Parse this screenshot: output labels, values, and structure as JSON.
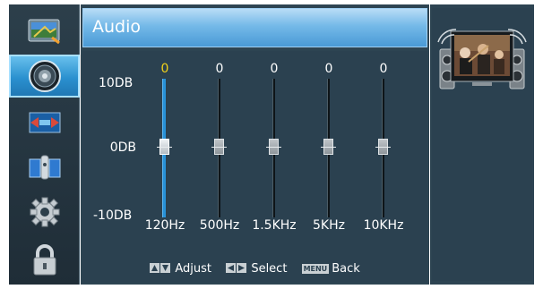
{
  "menu": {
    "title": "Audio",
    "sidebar": [
      {
        "icon": "picture-icon",
        "selected": false
      },
      {
        "icon": "speaker-icon",
        "selected": true
      },
      {
        "icon": "screen-icon",
        "selected": false
      },
      {
        "icon": "satellite-icon",
        "selected": false
      },
      {
        "icon": "gear-icon",
        "selected": false
      },
      {
        "icon": "lock-icon",
        "selected": false
      }
    ]
  },
  "equalizer": {
    "db_labels": {
      "top": "10DB",
      "mid": "0DB",
      "bottom": "-10DB"
    },
    "bands": [
      {
        "freq": "120Hz",
        "value": "0",
        "active": true
      },
      {
        "freq": "500Hz",
        "value": "0",
        "active": false
      },
      {
        "freq": "1.5KHz",
        "value": "0",
        "active": false
      },
      {
        "freq": "5KHz",
        "value": "0",
        "active": false
      },
      {
        "freq": "10KHz",
        "value": "0",
        "active": false
      }
    ],
    "range_db": [
      -10,
      10
    ]
  },
  "hints": {
    "adjust": "Adjust",
    "select": "Select",
    "menu_key": "MENU",
    "back": "Back"
  },
  "colors": {
    "highlight": "#2a90cf",
    "active_value": "#f2d21a",
    "panel": "#2d4452"
  },
  "preview": {
    "icon": "tv-preview-icon"
  }
}
